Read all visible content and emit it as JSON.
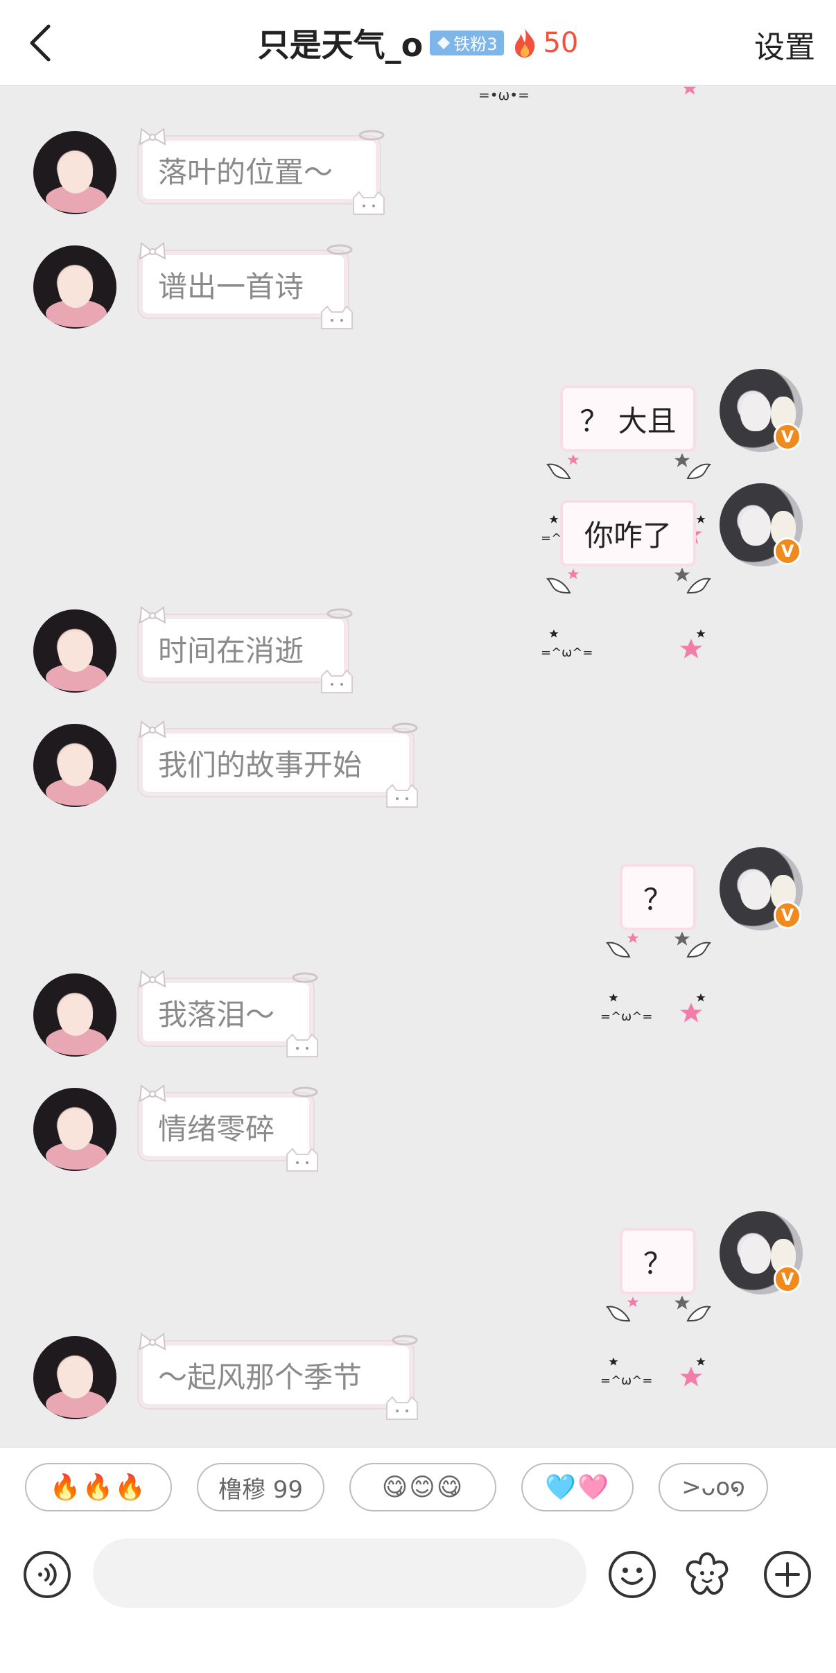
{
  "header": {
    "title": "只是天气_o",
    "fan_badge": "铁粉3",
    "fire_count": "50",
    "settings_label": "设置"
  },
  "chat": {
    "top_remnant_face": "=•ω•=",
    "messages": [
      {
        "side": "left",
        "text": "落叶的位置～"
      },
      {
        "side": "left",
        "text": "谱出一首诗"
      },
      {
        "side": "right",
        "text": "？ 大且",
        "face": "=^ω^="
      },
      {
        "side": "right",
        "text": "你咋了",
        "face": "=^ω^="
      },
      {
        "side": "left",
        "text": "时间在消逝"
      },
      {
        "side": "left",
        "text": "我们的故事开始"
      },
      {
        "side": "right",
        "text": "？",
        "face": "=^ω^="
      },
      {
        "side": "left",
        "text": "我落泪～"
      },
      {
        "side": "left",
        "text": "情绪零碎"
      },
      {
        "side": "right",
        "text": "？",
        "face": "=^ω^="
      },
      {
        "side": "left",
        "text": "～起风那个季节"
      }
    ],
    "verified_badge": "V"
  },
  "quick_replies": {
    "fire": "🔥🔥🔥",
    "lumu": "橹穆 99",
    "smiles": "😋😊😋",
    "hearts": "🩵🩷",
    "kaomoji": ">ᴗo໑"
  },
  "input": {
    "placeholder": ""
  },
  "icons": {
    "back": "chevron-left-icon",
    "voice": "voice-icon",
    "emoji": "smiley-icon",
    "sticker": "flower-sticker-icon",
    "add": "plus-icon"
  },
  "colors": {
    "fire_count": "#f0523d",
    "fan_badge": "#7fb6ea",
    "verified": "#f08a1d",
    "bubble_border_pink": "#f9dde6"
  }
}
